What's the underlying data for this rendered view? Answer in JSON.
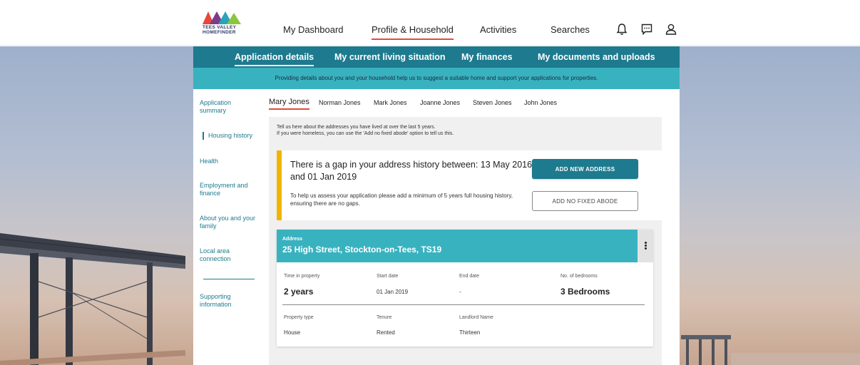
{
  "app": {
    "logo_line1": "TEES VALLEY",
    "logo_line2": "HOMEFINDER"
  },
  "top_nav": {
    "items": [
      {
        "label": "My Dashboard"
      },
      {
        "label": "Profile & Household",
        "active": true
      },
      {
        "label": "Activities"
      },
      {
        "label": "Searches"
      }
    ],
    "icons": [
      "bell-icon",
      "chat-icon",
      "user-icon"
    ]
  },
  "sub_nav": {
    "items": [
      {
        "label": "Application details",
        "active": true
      },
      {
        "label": "My current living situation"
      },
      {
        "label": "My finances"
      },
      {
        "label": "My documents and uploads"
      }
    ]
  },
  "banner": {
    "text": "Providing details about you and your household help us to suggest a suitable home and support your applications for properties."
  },
  "sidebar": {
    "items": [
      {
        "label": "Application summary"
      },
      {
        "label": "Housing history",
        "active": true
      },
      {
        "label": "Health"
      },
      {
        "label": "Employment and finance"
      },
      {
        "label": "About you and your family"
      },
      {
        "label": "Local area connection"
      },
      {
        "label": "Supporting information"
      }
    ]
  },
  "people": {
    "tabs": [
      "Mary Jones",
      "Norman Jones",
      "Mark Jones",
      "Joanne Jones",
      "Steven Jones",
      "John Jones"
    ],
    "active_index": 0
  },
  "intro": {
    "line1": "Tell us here about the addresses you have lived at over the last 5 years.",
    "line2": "If you were homeless, you can use the 'Add no fixed abode' option to tell us this."
  },
  "gap_alert": {
    "title": "There is a gap in your address history between: 13 May 2016 and 01 Jan 2019",
    "description": "To help us assess your application please add a minimum of 5 years full housing history, ensuring there are no gaps.",
    "primary_button": "ADD NEW ADDRESS",
    "secondary_button": "ADD NO FIXED ABODE"
  },
  "address": {
    "kicker": "Address",
    "line": "25 High Street, Stockton-on-Tees, TS19",
    "fields": {
      "time_label": "Time in property",
      "time_value": "2 years",
      "start_label": "Start date",
      "start_value": "01 Jan 2019",
      "end_label": "End date",
      "end_value": "-",
      "bedrooms_label": "No. of bedrooms",
      "bedrooms_value": "3 Bedrooms",
      "type_label": "Property type",
      "type_value": "House",
      "tenure_label": "Tenure",
      "tenure_value": "Rented",
      "landlord_label": "Landlord Name",
      "landlord_value": "Thirteen"
    }
  },
  "colors": {
    "primary": "#1e7a8e",
    "light_teal": "#39b2c0",
    "warning": "#f0b400",
    "accent": "#e14c3a"
  }
}
